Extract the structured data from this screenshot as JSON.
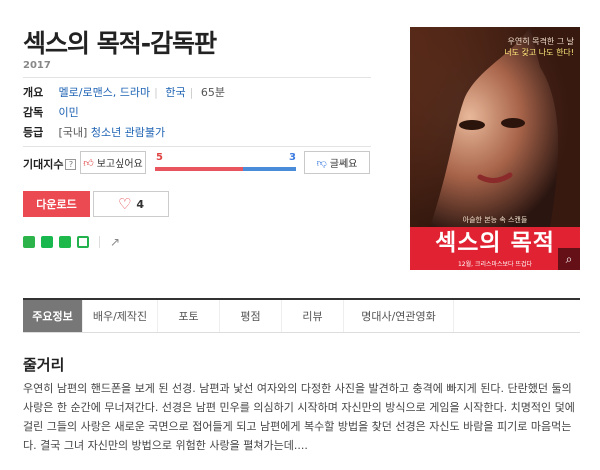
{
  "title": "섹스의 목적-감독판",
  "year": "2017",
  "info": {
    "overview_label": "개요",
    "genre": "멜로/로맨스, 드라마",
    "country": "한국",
    "runtime": "65분",
    "director_label": "감독",
    "director": "이민",
    "rating_label": "등급",
    "rating_prefix": "[국내]",
    "rating": "청소년 관람불가"
  },
  "expect": {
    "label": "기대지수",
    "help": "?",
    "want_label": "보고싶어요",
    "want_count": "5",
    "no_count": "3",
    "no_label": "글쎄요",
    "want_fraction": 0.625
  },
  "actions": {
    "download_label": "다운로드",
    "like_count": "4"
  },
  "poster": {
    "tagline_1": "우연히 목격한 그 날",
    "tagline_2": "너도 갖고 나도 한다!",
    "mid_tagline": "아슬한 본능 속 스캔들",
    "title_big": "섹스의 목적",
    "bottom": "12월, 크리스마스보다 뜨겁다"
  },
  "tabs": [
    "주요정보",
    "배우/제작진",
    "포토",
    "평점",
    "리뷰",
    "명대사/연관영화"
  ],
  "synopsis": {
    "heading": "줄거리",
    "text": "우연히 남편의 핸드폰을 보게 된 선경. 남편과 낯선 여자와의 다정한 사진을 발견하고 충격에 빠지게 된다. 단란했던 둘의 사랑은 한 순간에 무너져간다. 선경은 남편 민우를 의심하기 시작하며 자신만의 방식으로 게임을 시작한다. 치명적인 덫에 걸린 그들의 사랑은 새로운 국면으로 접어들게 되고 남편에게 복수할 방법을 찾던 선경은 자신도 바람을 피기로 마음먹는다. 결국 그녀 자신만의 방법으로 위험한 사랑을 펼쳐가는데...."
  },
  "colors": {
    "accent_red": "#ec4a52",
    "accent_blue": "#4b8cd9",
    "link": "#1e63b4"
  }
}
